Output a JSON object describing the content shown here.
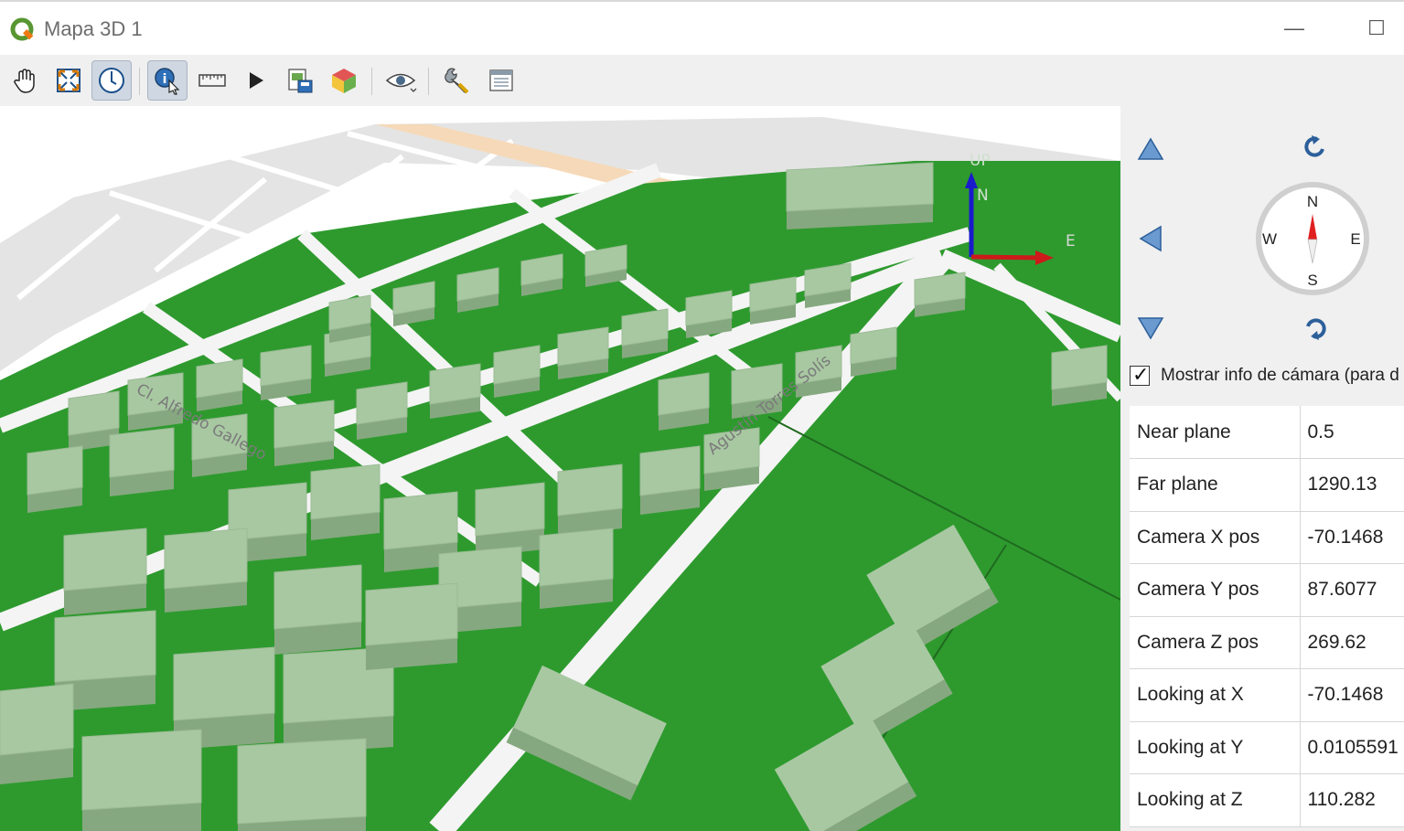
{
  "window": {
    "title": "Mapa 3D 1",
    "minimize_glyph": "—",
    "maximize_glyph": "☐"
  },
  "toolbar": {
    "buttons": [
      {
        "name": "pan-button",
        "icon": "hand-icon",
        "active": false
      },
      {
        "name": "zoom-full-button",
        "icon": "zoom-full-icon",
        "active": false
      },
      {
        "name": "camera-control-button",
        "icon": "compass-circle-icon",
        "active": true
      },
      {
        "name": "identify-button",
        "icon": "identify-icon",
        "active": true
      },
      {
        "name": "measure-button",
        "icon": "ruler-icon",
        "active": false
      },
      {
        "name": "animation-button",
        "icon": "play-icon",
        "active": false
      },
      {
        "name": "save-image-button",
        "icon": "save-image-icon",
        "active": false
      },
      {
        "name": "export-3d-button",
        "icon": "cube-icon",
        "active": false
      },
      {
        "name": "visibility-button",
        "icon": "eye-icon",
        "active": false
      },
      {
        "name": "configure-button",
        "icon": "wrench-icon",
        "active": false
      },
      {
        "name": "options-button",
        "icon": "panel-icon",
        "active": false
      }
    ]
  },
  "map": {
    "streets": [
      "Cl. Alfredo Gallego",
      "Agustín Torres Solís"
    ],
    "axis_labels": {
      "up": "UP",
      "north": "N",
      "east": "E"
    },
    "colors": {
      "grass": "#2e9a2e",
      "building": "#a8c8a2",
      "road": "#f4f4f4",
      "highway": "#f6d9b8",
      "parcel": "#e2e2e2"
    }
  },
  "camera_nav": {
    "compass": {
      "north": "N",
      "south": "S",
      "east": "E",
      "west": "W",
      "needle_color": "#e02020"
    }
  },
  "camera_info": {
    "checkbox_label": "Mostrar info de cámara (para d",
    "checked": true,
    "rows": [
      {
        "key": "Near plane",
        "value": "0.5"
      },
      {
        "key": "Far plane",
        "value": "1290.13"
      },
      {
        "key": "Camera X pos",
        "value": "-70.1468"
      },
      {
        "key": "Camera Y pos",
        "value": "87.6077"
      },
      {
        "key": "Camera Z pos",
        "value": "269.62"
      },
      {
        "key": "Looking at X",
        "value": "-70.1468"
      },
      {
        "key": "Looking at Y",
        "value": "0.0105591"
      },
      {
        "key": "Looking at Z",
        "value": "110.282"
      }
    ]
  }
}
